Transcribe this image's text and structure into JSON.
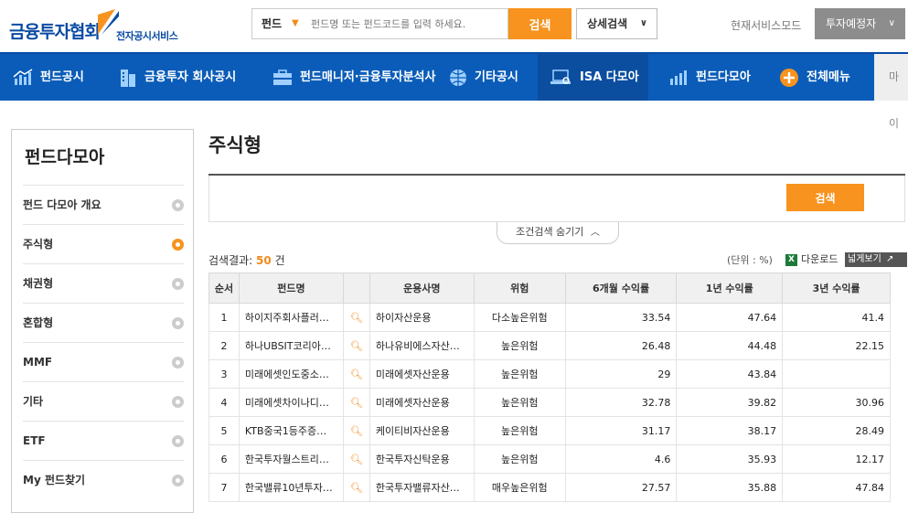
{
  "header": {
    "logo_main": "금융투자협회",
    "logo_sub": "전자공시서비스",
    "search_select": "펀드",
    "search_placeholder": "펀드명 또는 펀드코드를 입력 하세요.",
    "search_button": "검색",
    "advanced_search": "상세검색",
    "mode_label": "현재서비스모드",
    "mode_value": "투자예정자"
  },
  "nav": {
    "items": [
      {
        "label": "펀드공시",
        "icon": "bar-chart-icon"
      },
      {
        "label": "금융투자 회사공시",
        "icon": "building-icon"
      },
      {
        "label": "펀드매니저·금융투자분석사",
        "icon": "briefcase-icon"
      },
      {
        "label": "기타공시",
        "icon": "globe-icon"
      },
      {
        "label": "ISA 다모아",
        "icon": "laptop-search-icon"
      },
      {
        "label": "펀드다모아",
        "icon": "column-chart-icon"
      },
      {
        "label": "전체메뉴",
        "icon": "plus-circle-icon"
      }
    ],
    "my": "마이"
  },
  "sidebar": {
    "title": "펀드다모아",
    "items": [
      {
        "label": "펀드 다모아 개요",
        "active": false
      },
      {
        "label": "주식형",
        "active": true
      },
      {
        "label": "채권형",
        "active": false
      },
      {
        "label": "혼합형",
        "active": false
      },
      {
        "label": "MMF",
        "active": false
      },
      {
        "label": "기타",
        "active": false
      },
      {
        "label": "ETF",
        "active": false
      },
      {
        "label": "My 펀드찾기",
        "active": false
      }
    ]
  },
  "main": {
    "title": "주식형",
    "search_button": "검색",
    "toggle_label": "조건검색 숨기기",
    "result_label": "검색결과:",
    "result_count": "50",
    "result_unit": "건",
    "unit_label": "(단위 : %)",
    "download": "다운로드",
    "wide_view": "넓게보기"
  },
  "table": {
    "headers": [
      "순서",
      "펀드명",
      "",
      "운용사명",
      "위험",
      "6개월 수익률",
      "1년 수익률",
      "3년 수익률"
    ],
    "rows": [
      {
        "no": "1",
        "fund": "하이지주회사플러…",
        "company": "하이자산운용",
        "risk": "다소높은위험",
        "m6": "33.54",
        "y1": "47.64",
        "y3": "41.4"
      },
      {
        "no": "2",
        "fund": "하나UBSIT코리아…",
        "company": "하나유비에스자산…",
        "risk": "높은위험",
        "m6": "26.48",
        "y1": "44.48",
        "y3": "22.15"
      },
      {
        "no": "3",
        "fund": "미래에셋인도중소…",
        "company": "미래에셋자산운용",
        "risk": "높은위험",
        "m6": "29",
        "y1": "43.84",
        "y3": ""
      },
      {
        "no": "4",
        "fund": "미래에셋차이나디…",
        "company": "미래에셋자산운용",
        "risk": "높은위험",
        "m6": "32.78",
        "y1": "39.82",
        "y3": "30.96"
      },
      {
        "no": "5",
        "fund": "KTB중국1등주증…",
        "company": "케이티비자산운용",
        "risk": "높은위험",
        "m6": "31.17",
        "y1": "38.17",
        "y3": "28.49"
      },
      {
        "no": "6",
        "fund": "한국투자월스트리…",
        "company": "한국투자신탁운용",
        "risk": "높은위험",
        "m6": "4.6",
        "y1": "35.93",
        "y3": "12.17"
      },
      {
        "no": "7",
        "fund": "한국밸류10년투자…",
        "company": "한국투자밸류자산…",
        "risk": "매우높은위험",
        "m6": "27.57",
        "y1": "35.88",
        "y3": "47.84"
      }
    ]
  }
}
